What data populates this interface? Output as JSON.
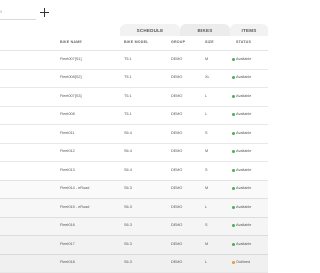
{
  "toolbar": {
    "search_placeholder": "s",
    "add_icon": "plus-icon"
  },
  "tabs": [
    {
      "label": "SCHEDULE"
    },
    {
      "label": "BIKES"
    },
    {
      "label": "ITEMS"
    }
  ],
  "table": {
    "headers": {
      "name": "BIKE NAME",
      "model": "BIKE MODEL",
      "group": "GROUP",
      "size": "SIZE",
      "status": "STATUS"
    },
    "rows": [
      {
        "name": "Fleet007[S1]",
        "model": "T5.1",
        "group": "DEMO",
        "size": "M",
        "status": "Available"
      },
      {
        "name": "Fleet008[S2]",
        "model": "T5.1",
        "group": "DEMO",
        "size": "XL",
        "status": "Available"
      },
      {
        "name": "Fleet007[S3]",
        "model": "T5.1",
        "group": "DEMO",
        "size": "L",
        "status": "Available"
      },
      {
        "name": "Fleet008",
        "model": "T5.1",
        "group": "DEMO",
        "size": "L",
        "status": "Available"
      },
      {
        "name": "Fleet011",
        "model": "S6.4",
        "group": "DEMO",
        "size": "S",
        "status": "Available"
      },
      {
        "name": "Fleet012",
        "model": "S6.4",
        "group": "DEMO",
        "size": "M",
        "status": "Available"
      },
      {
        "name": "Fleet013",
        "model": "S6.4",
        "group": "DEMO",
        "size": "S",
        "status": "Available"
      },
      {
        "name": "Fleet014 - eRoad",
        "model": "S6.3",
        "group": "DEMO",
        "size": "M",
        "status": "Available"
      },
      {
        "name": "Fleet015 - eRoad",
        "model": "S6.3",
        "group": "DEMO",
        "size": "L",
        "status": "Available"
      },
      {
        "name": "Fleet016",
        "model": "S6.3",
        "group": "DEMO",
        "size": "S",
        "status": "Available"
      },
      {
        "name": "Fleet017",
        "model": "S6.3",
        "group": "DEMO",
        "size": "M",
        "status": "Available"
      },
      {
        "name": "Fleet018",
        "model": "S6.3",
        "group": "DEMO",
        "size": "L",
        "status": "Outlined"
      }
    ]
  },
  "colors": {
    "available": "#4caf50",
    "outlined": "#e0a030"
  }
}
